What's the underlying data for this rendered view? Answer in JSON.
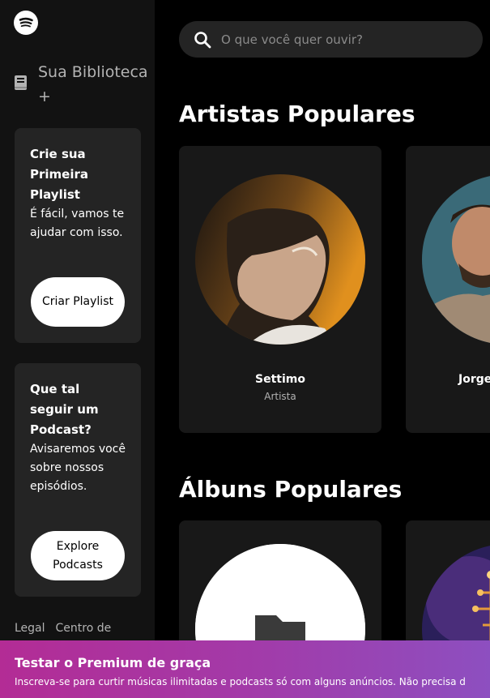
{
  "app": {
    "logo_icon": "spotify-logo-icon"
  },
  "sidebar": {
    "library_label": "Sua Biblioteca +",
    "library_icon": "library-book-icon",
    "cards": [
      {
        "title": "Crie sua Primeira Playlist",
        "description": "É fácil, vamos te ajudar com isso.",
        "button": "Criar Playlist"
      },
      {
        "title": "Que tal seguir um Podcast?",
        "description": "Avisaremos você sobre nossos episódios.",
        "button": "Explore Podcasts"
      }
    ],
    "footer_links": [
      "Legal",
      "Centro de"
    ]
  },
  "search": {
    "placeholder": "O que você quer ouvir?",
    "icon": "search-icon"
  },
  "sections": {
    "artists_title": "Artistas Populares",
    "albums_title": "Álbuns Populares"
  },
  "artists": [
    {
      "name": "Settimo",
      "type": "Artista"
    },
    {
      "name": "Jorge",
      "type": ""
    }
  ],
  "banner": {
    "title": "Testar o Premium de graça",
    "text": "Inscreva-se para curtir músicas ilimitadas e podcasts só com alguns anúncios. Não precisa d"
  },
  "colors": {
    "sidebar_bg": "#121212",
    "card_bg": "#242424",
    "tile_bg": "#181818",
    "banner_start": "#b32c95",
    "banner_end": "#8d4fc0"
  }
}
